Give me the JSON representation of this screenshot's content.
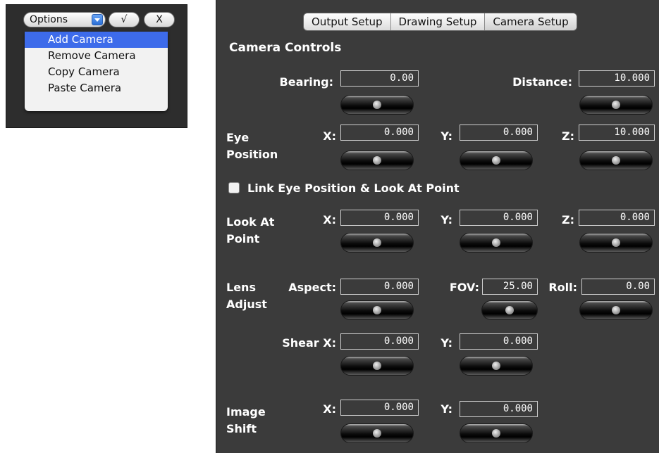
{
  "options_widget": {
    "options_label": "Options",
    "confirm_label": "√",
    "cancel_label": "X",
    "menu_items": [
      "Add Camera",
      "Remove Camera",
      "Copy Camera",
      "Paste Camera"
    ],
    "selected_index": 0
  },
  "tabs": [
    "Output Setup",
    "Drawing Setup",
    "Camera Setup"
  ],
  "active_tab": "Camera Setup",
  "camera_controls": {
    "title": "Camera Controls",
    "bearing": {
      "label": "Bearing:",
      "value": "0.00"
    },
    "distance": {
      "label": "Distance:",
      "value": "10.000"
    },
    "eye_position": {
      "label_line1": "Eye",
      "label_line2": "Position",
      "x": {
        "label": "X:",
        "value": "0.000"
      },
      "y": {
        "label": "Y:",
        "value": "0.000"
      },
      "z": {
        "label": "Z:",
        "value": "10.000"
      }
    },
    "link_checkbox": {
      "label": "Link Eye Position & Look At Point",
      "checked": false
    },
    "look_at": {
      "label_line1": "Look At",
      "label_line2": "Point",
      "x": {
        "label": "X:",
        "value": "0.000"
      },
      "y": {
        "label": "Y:",
        "value": "0.000"
      },
      "z": {
        "label": "Z:",
        "value": "0.000"
      }
    },
    "lens_adjust": {
      "label_line1": "Lens",
      "label_line2": "Adjust",
      "aspect": {
        "label": "Aspect:",
        "value": "0.000"
      },
      "fov": {
        "label": "FOV:",
        "value": "25.00"
      },
      "roll": {
        "label": "Roll:",
        "value": "0.00"
      }
    },
    "shear": {
      "x": {
        "label": "Shear X:",
        "value": "0.000"
      },
      "y": {
        "label": "Y:",
        "value": "0.000"
      }
    },
    "image_shift": {
      "label_line1": "Image",
      "label_line2": "Shift",
      "x": {
        "label": "X:",
        "value": "0.000"
      },
      "y": {
        "label": "Y:",
        "value": "0.000"
      }
    }
  }
}
